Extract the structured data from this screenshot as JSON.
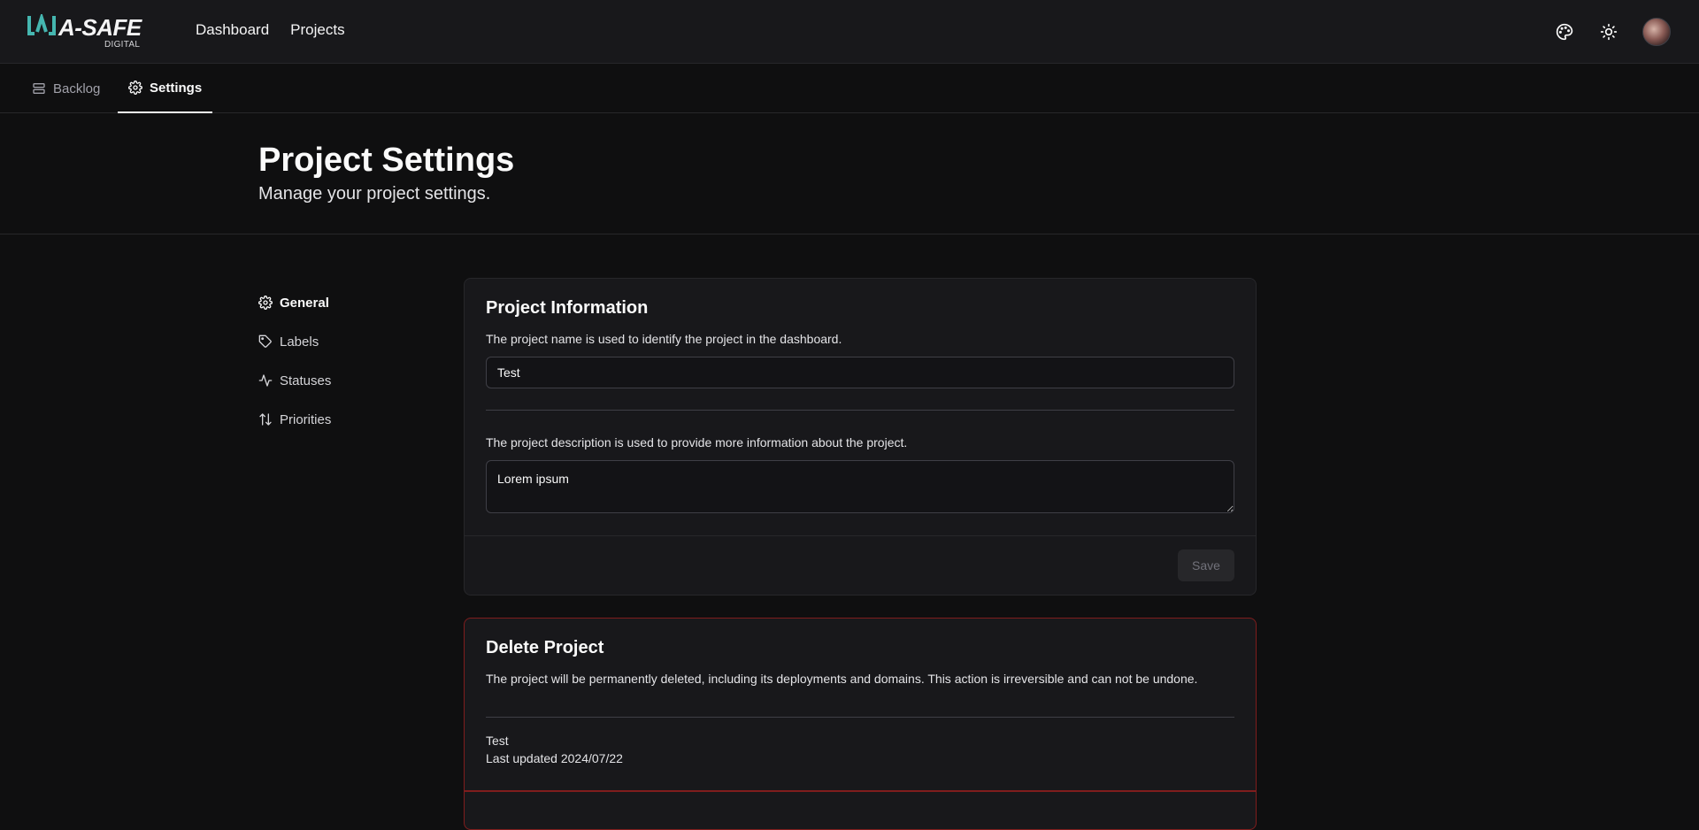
{
  "brand": {
    "name": "A-SAFE",
    "sub": "DIGITAL"
  },
  "nav": {
    "items": [
      {
        "label": "Dashboard"
      },
      {
        "label": "Projects"
      }
    ]
  },
  "header_icons": {
    "theme_icon": "palette-icon",
    "mode_icon": "sun-icon",
    "avatar": "user-avatar"
  },
  "subnav": {
    "tabs": [
      {
        "label": "Backlog",
        "icon": "backlog-icon"
      },
      {
        "label": "Settings",
        "icon": "gear-icon",
        "active": true
      }
    ]
  },
  "page": {
    "title": "Project Settings",
    "subtitle": "Manage your project settings."
  },
  "side": {
    "items": [
      {
        "label": "General",
        "icon": "gear-icon",
        "active": true
      },
      {
        "label": "Labels",
        "icon": "tag-icon"
      },
      {
        "label": "Statuses",
        "icon": "activity-icon"
      },
      {
        "label": "Priorities",
        "icon": "arrow-up-down-icon"
      }
    ]
  },
  "info": {
    "title": "Project Information",
    "name_desc": "The project name is used to identify the project in the dashboard.",
    "name_value": "Test",
    "desc_desc": "The project description is used to provide more information about the project.",
    "desc_value": "Lorem ipsum",
    "save_label": "Save"
  },
  "danger": {
    "title": "Delete Project",
    "desc": "The project will be permanently deleted, including its deployments and domains. This action is irreversible and can not be undone.",
    "project_name": "Test",
    "last_updated": "Last updated 2024/07/22"
  },
  "colors": {
    "background": "#0f0f10",
    "surface": "#18181b",
    "border": "#27272a",
    "danger_border": "#7f1d1d",
    "logo_accent": "#45b6b0"
  }
}
